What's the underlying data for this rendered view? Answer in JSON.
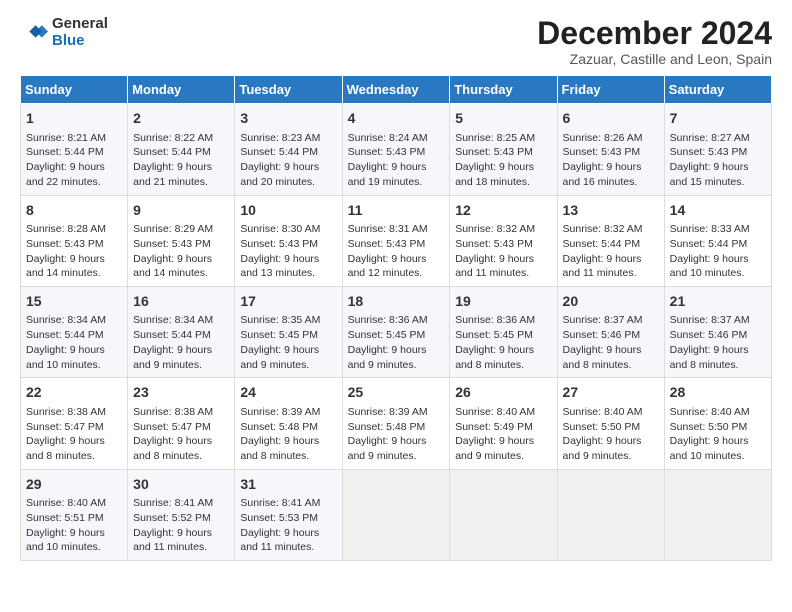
{
  "logo": {
    "general": "General",
    "blue": "Blue"
  },
  "title": "December 2024",
  "subtitle": "Zazuar, Castille and Leon, Spain",
  "days_of_week": [
    "Sunday",
    "Monday",
    "Tuesday",
    "Wednesday",
    "Thursday",
    "Friday",
    "Saturday"
  ],
  "weeks": [
    [
      {
        "day": 1,
        "lines": [
          "Sunrise: 8:21 AM",
          "Sunset: 5:44 PM",
          "Daylight: 9 hours",
          "and 22 minutes."
        ]
      },
      {
        "day": 2,
        "lines": [
          "Sunrise: 8:22 AM",
          "Sunset: 5:44 PM",
          "Daylight: 9 hours",
          "and 21 minutes."
        ]
      },
      {
        "day": 3,
        "lines": [
          "Sunrise: 8:23 AM",
          "Sunset: 5:44 PM",
          "Daylight: 9 hours",
          "and 20 minutes."
        ]
      },
      {
        "day": 4,
        "lines": [
          "Sunrise: 8:24 AM",
          "Sunset: 5:43 PM",
          "Daylight: 9 hours",
          "and 19 minutes."
        ]
      },
      {
        "day": 5,
        "lines": [
          "Sunrise: 8:25 AM",
          "Sunset: 5:43 PM",
          "Daylight: 9 hours",
          "and 18 minutes."
        ]
      },
      {
        "day": 6,
        "lines": [
          "Sunrise: 8:26 AM",
          "Sunset: 5:43 PM",
          "Daylight: 9 hours",
          "and 16 minutes."
        ]
      },
      {
        "day": 7,
        "lines": [
          "Sunrise: 8:27 AM",
          "Sunset: 5:43 PM",
          "Daylight: 9 hours",
          "and 15 minutes."
        ]
      }
    ],
    [
      {
        "day": 8,
        "lines": [
          "Sunrise: 8:28 AM",
          "Sunset: 5:43 PM",
          "Daylight: 9 hours",
          "and 14 minutes."
        ]
      },
      {
        "day": 9,
        "lines": [
          "Sunrise: 8:29 AM",
          "Sunset: 5:43 PM",
          "Daylight: 9 hours",
          "and 14 minutes."
        ]
      },
      {
        "day": 10,
        "lines": [
          "Sunrise: 8:30 AM",
          "Sunset: 5:43 PM",
          "Daylight: 9 hours",
          "and 13 minutes."
        ]
      },
      {
        "day": 11,
        "lines": [
          "Sunrise: 8:31 AM",
          "Sunset: 5:43 PM",
          "Daylight: 9 hours",
          "and 12 minutes."
        ]
      },
      {
        "day": 12,
        "lines": [
          "Sunrise: 8:32 AM",
          "Sunset: 5:43 PM",
          "Daylight: 9 hours",
          "and 11 minutes."
        ]
      },
      {
        "day": 13,
        "lines": [
          "Sunrise: 8:32 AM",
          "Sunset: 5:44 PM",
          "Daylight: 9 hours",
          "and 11 minutes."
        ]
      },
      {
        "day": 14,
        "lines": [
          "Sunrise: 8:33 AM",
          "Sunset: 5:44 PM",
          "Daylight: 9 hours",
          "and 10 minutes."
        ]
      }
    ],
    [
      {
        "day": 15,
        "lines": [
          "Sunrise: 8:34 AM",
          "Sunset: 5:44 PM",
          "Daylight: 9 hours",
          "and 10 minutes."
        ]
      },
      {
        "day": 16,
        "lines": [
          "Sunrise: 8:34 AM",
          "Sunset: 5:44 PM",
          "Daylight: 9 hours",
          "and 9 minutes."
        ]
      },
      {
        "day": 17,
        "lines": [
          "Sunrise: 8:35 AM",
          "Sunset: 5:45 PM",
          "Daylight: 9 hours",
          "and 9 minutes."
        ]
      },
      {
        "day": 18,
        "lines": [
          "Sunrise: 8:36 AM",
          "Sunset: 5:45 PM",
          "Daylight: 9 hours",
          "and 9 minutes."
        ]
      },
      {
        "day": 19,
        "lines": [
          "Sunrise: 8:36 AM",
          "Sunset: 5:45 PM",
          "Daylight: 9 hours",
          "and 8 minutes."
        ]
      },
      {
        "day": 20,
        "lines": [
          "Sunrise: 8:37 AM",
          "Sunset: 5:46 PM",
          "Daylight: 9 hours",
          "and 8 minutes."
        ]
      },
      {
        "day": 21,
        "lines": [
          "Sunrise: 8:37 AM",
          "Sunset: 5:46 PM",
          "Daylight: 9 hours",
          "and 8 minutes."
        ]
      }
    ],
    [
      {
        "day": 22,
        "lines": [
          "Sunrise: 8:38 AM",
          "Sunset: 5:47 PM",
          "Daylight: 9 hours",
          "and 8 minutes."
        ]
      },
      {
        "day": 23,
        "lines": [
          "Sunrise: 8:38 AM",
          "Sunset: 5:47 PM",
          "Daylight: 9 hours",
          "and 8 minutes."
        ]
      },
      {
        "day": 24,
        "lines": [
          "Sunrise: 8:39 AM",
          "Sunset: 5:48 PM",
          "Daylight: 9 hours",
          "and 8 minutes."
        ]
      },
      {
        "day": 25,
        "lines": [
          "Sunrise: 8:39 AM",
          "Sunset: 5:48 PM",
          "Daylight: 9 hours",
          "and 9 minutes."
        ]
      },
      {
        "day": 26,
        "lines": [
          "Sunrise: 8:40 AM",
          "Sunset: 5:49 PM",
          "Daylight: 9 hours",
          "and 9 minutes."
        ]
      },
      {
        "day": 27,
        "lines": [
          "Sunrise: 8:40 AM",
          "Sunset: 5:50 PM",
          "Daylight: 9 hours",
          "and 9 minutes."
        ]
      },
      {
        "day": 28,
        "lines": [
          "Sunrise: 8:40 AM",
          "Sunset: 5:50 PM",
          "Daylight: 9 hours",
          "and 10 minutes."
        ]
      }
    ],
    [
      {
        "day": 29,
        "lines": [
          "Sunrise: 8:40 AM",
          "Sunset: 5:51 PM",
          "Daylight: 9 hours",
          "and 10 minutes."
        ]
      },
      {
        "day": 30,
        "lines": [
          "Sunrise: 8:41 AM",
          "Sunset: 5:52 PM",
          "Daylight: 9 hours",
          "and 11 minutes."
        ]
      },
      {
        "day": 31,
        "lines": [
          "Sunrise: 8:41 AM",
          "Sunset: 5:53 PM",
          "Daylight: 9 hours",
          "and 11 minutes."
        ]
      },
      null,
      null,
      null,
      null
    ]
  ]
}
